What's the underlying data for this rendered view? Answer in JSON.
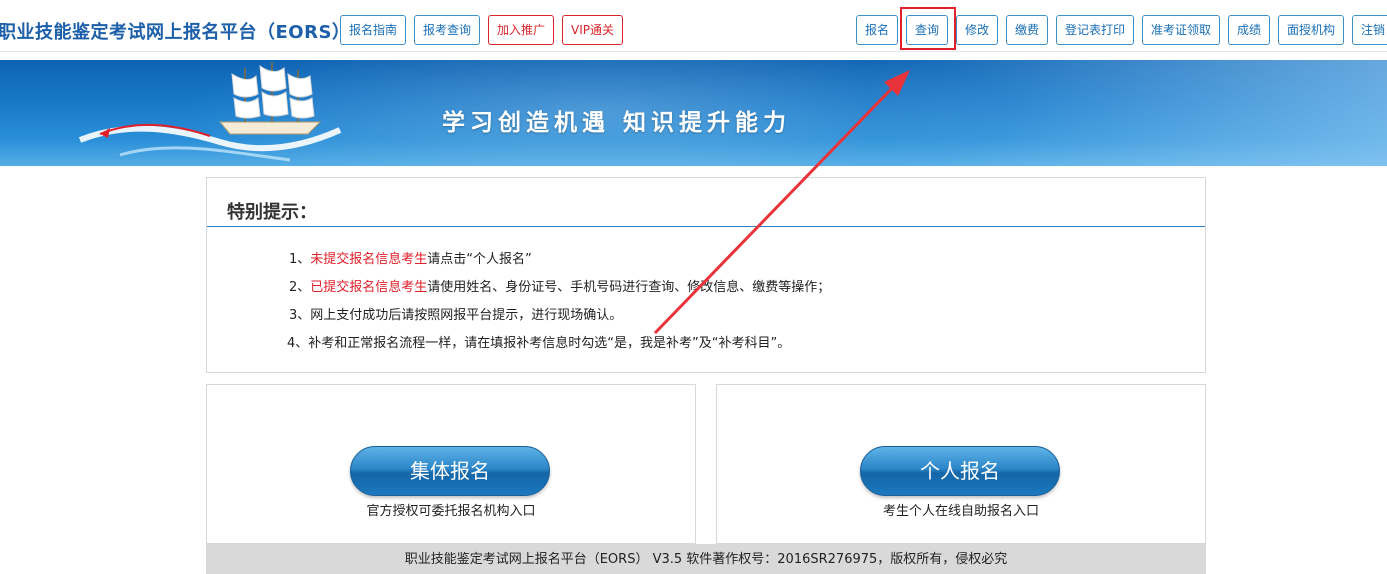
{
  "header": {
    "site_title": "职业技能鉴定考试网上报名平台（EORS）",
    "left_nav": [
      {
        "label": "报名指南",
        "style": "blue"
      },
      {
        "label": "报考查询",
        "style": "blue"
      },
      {
        "label": "加入推广",
        "style": "red"
      },
      {
        "label": "VIP通关",
        "style": "red"
      }
    ],
    "right_nav": [
      {
        "label": "报名"
      },
      {
        "label": "查询",
        "highlighted": true
      },
      {
        "label": "修改"
      },
      {
        "label": "缴费"
      },
      {
        "label": "登记表打印"
      },
      {
        "label": "准考证领取"
      },
      {
        "label": "成绩"
      },
      {
        "label": "面授机构"
      },
      {
        "label": "注销"
      }
    ]
  },
  "banner": {
    "slogan": "学习创造机遇  知识提升能力",
    "icon": "sailing-ship-icon"
  },
  "notice": {
    "title": "特别提示：",
    "lines": [
      {
        "prefix": "1、",
        "highlight": "未提交报名信息考生",
        "rest": "请点击“个人报名”"
      },
      {
        "prefix": "2、",
        "highlight": "已提交报名信息考生",
        "rest": "请使用姓名、身份证号、手机号码进行查询、修改信息、缴费等操作；"
      },
      {
        "prefix": "3、",
        "highlight": "",
        "rest": "网上支付成功后请按照网报平台提示，进行现场确认。"
      },
      {
        "prefix": "4、",
        "highlight": "",
        "rest": "补考和正常报名流程一样，请在填报补考信息时勾选“是，我是补考”及“补考科目”。"
      }
    ]
  },
  "entries": {
    "group": {
      "button": "集体报名",
      "subtitle": "官方授权可委托报名机构入口"
    },
    "individual": {
      "button": "个人报名",
      "subtitle": "考生个人在线自助报名入口"
    }
  },
  "footer": {
    "text": "职业技能鉴定考试网上报名平台（EORS） V3.5 软件著作权号：2016SR276975，版权所有，侵权必究"
  },
  "colors": {
    "brand_blue": "#1d5fa8",
    "nav_border": "#3d8fc9",
    "accent_red": "#e0202a",
    "banner_blue": "#1879c9"
  }
}
